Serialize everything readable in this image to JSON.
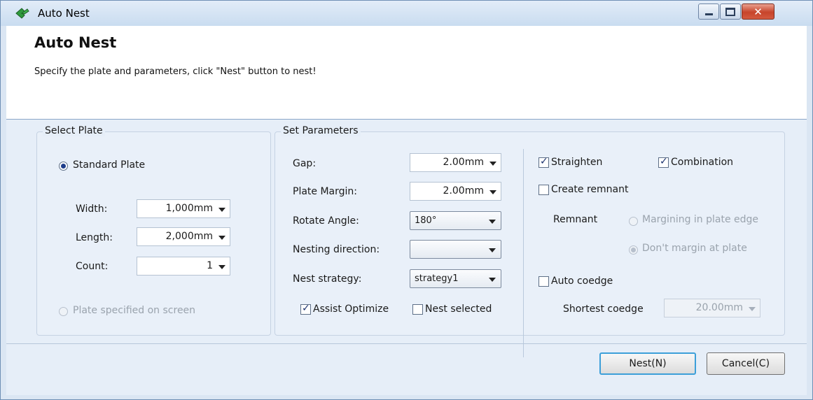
{
  "window": {
    "title": "Auto Nest"
  },
  "header": {
    "title": "Auto Nest",
    "description": "Specify the plate and parameters, click \"Nest\" button to nest!"
  },
  "select_plate": {
    "legend": "Select Plate",
    "standard_plate_label": "Standard Plate",
    "standard_plate_selected": true,
    "width_label": "Width:",
    "width_value": "1,000mm",
    "length_label": "Length:",
    "length_value": "2,000mm",
    "count_label": "Count:",
    "count_value": "1",
    "screen_plate_label": "Plate specified on screen",
    "screen_plate_selected": false
  },
  "parameters": {
    "legend": "Set Parameters",
    "gap_label": "Gap:",
    "gap_value": "2.00mm",
    "plate_margin_label": "Plate Margin:",
    "plate_margin_value": "2.00mm",
    "rotate_angle_label": "Rotate Angle:",
    "rotate_angle_value": "180°",
    "nesting_direction_label": "Nesting direction:",
    "nesting_direction_value": "",
    "nest_strategy_label": "Nest strategy:",
    "nest_strategy_value": "strategy1",
    "assist_optimize_label": "Assist Optimize",
    "assist_optimize_checked": true,
    "nest_selected_label": "Nest selected",
    "nest_selected_checked": false
  },
  "options": {
    "straighten_label": "Straighten",
    "straighten_checked": true,
    "combination_label": "Combination",
    "combination_checked": true,
    "create_remnant_label": "Create remnant",
    "create_remnant_checked": false,
    "remnant_label": "Remnant",
    "margining_label": "Margining in plate edge",
    "dont_margin_label": "Don't margin at plate",
    "auto_coedge_label": "Auto coedge",
    "auto_coedge_checked": false,
    "shortest_coedge_label": "Shortest coedge",
    "shortest_coedge_value": "20.00mm"
  },
  "buttons": {
    "nest_label": "Nest(N)",
    "cancel_label": "Cancel(C)"
  }
}
